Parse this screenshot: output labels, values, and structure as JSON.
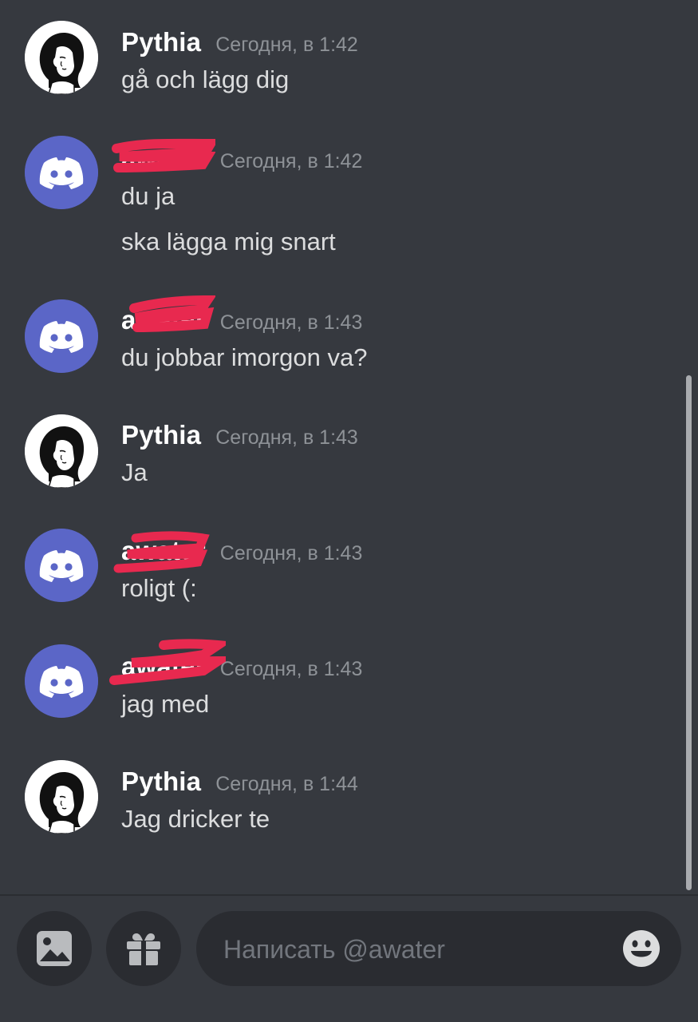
{
  "messages": [
    {
      "author": "Pythia",
      "avatar": "pythia-avatar",
      "timestamp": "Сегодня, в 1:42",
      "lines": [
        "gå och lägg dig"
      ]
    },
    {
      "author": "awater",
      "avatar": "discord-default-avatar",
      "timestamp": "Сегодня, в 1:42",
      "lines": [
        "du ja",
        "ska lägga mig snart"
      ]
    },
    {
      "author": "awater",
      "avatar": "discord-default-avatar",
      "timestamp": "Сегодня, в 1:43",
      "lines": [
        "du jobbar imorgon va?"
      ]
    },
    {
      "author": "Pythia",
      "avatar": "pythia-avatar",
      "timestamp": "Сегодня, в 1:43",
      "lines": [
        "Ja"
      ]
    },
    {
      "author": "awater",
      "avatar": "discord-default-avatar",
      "timestamp": "Сегодня, в 1:43",
      "lines": [
        "roligt (:"
      ]
    },
    {
      "author": "awater",
      "avatar": "discord-default-avatar",
      "timestamp": "Сегодня, в 1:43",
      "lines": [
        "jag med"
      ]
    },
    {
      "author": "Pythia",
      "avatar": "pythia-avatar",
      "timestamp": "Сегодня, в 1:44",
      "lines": [
        "Jag dricker te"
      ]
    }
  ],
  "composer": {
    "placeholder": "Написать @awater",
    "attach_icon": "image-icon",
    "gift_icon": "gift-icon",
    "emoji_icon": "emoji-icon"
  },
  "colors": {
    "background": "#36393f",
    "blurple": "#5b66c7",
    "redaction": "#e8294f",
    "username": "#ffffff",
    "text": "#dcddde",
    "muted": "#8e9297"
  }
}
